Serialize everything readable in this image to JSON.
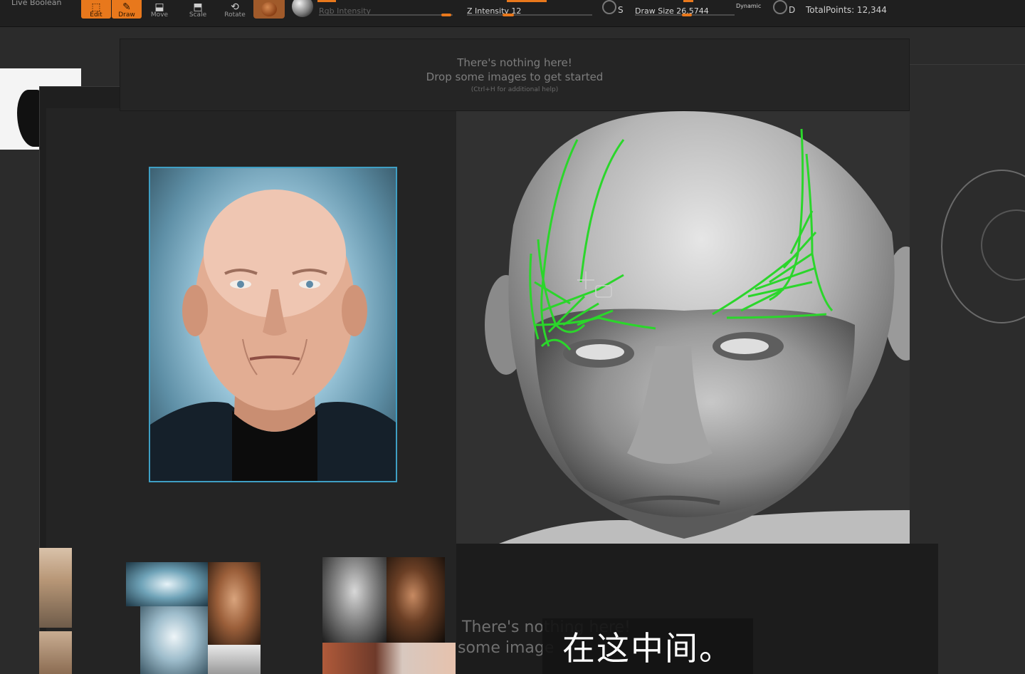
{
  "toolbar": {
    "live_boolean": "Live Boolean",
    "buttons": [
      {
        "label": "Edit",
        "icon": "edit-icon",
        "active": true
      },
      {
        "label": "Draw",
        "icon": "draw-icon",
        "active": true
      },
      {
        "label": "Move",
        "icon": "move-icon",
        "active": false
      },
      {
        "label": "Scale",
        "icon": "scale-icon",
        "active": false
      },
      {
        "label": "Rotate",
        "icon": "rotate-icon",
        "active": false
      }
    ],
    "rgb_intensity_label": "Rgb Intensity",
    "z_intensity_label": "Z Intensity 12",
    "s_key": "S",
    "draw_size_label": "Draw Size 26.5744",
    "dynamic_label": "Dynamic",
    "d_key": "D",
    "total_points": "TotalPoints: 12,344",
    "accent_color": "#e8781c"
  },
  "drop_zone_top": {
    "line1": "There's nothing here!",
    "line2": "Drop some images to get started",
    "hint": "(Ctrl+H for additional help)"
  },
  "drop_zone_bottom": {
    "line1": "There's nothing here!",
    "line2": "some image"
  },
  "subtitle": "在这中间。"
}
